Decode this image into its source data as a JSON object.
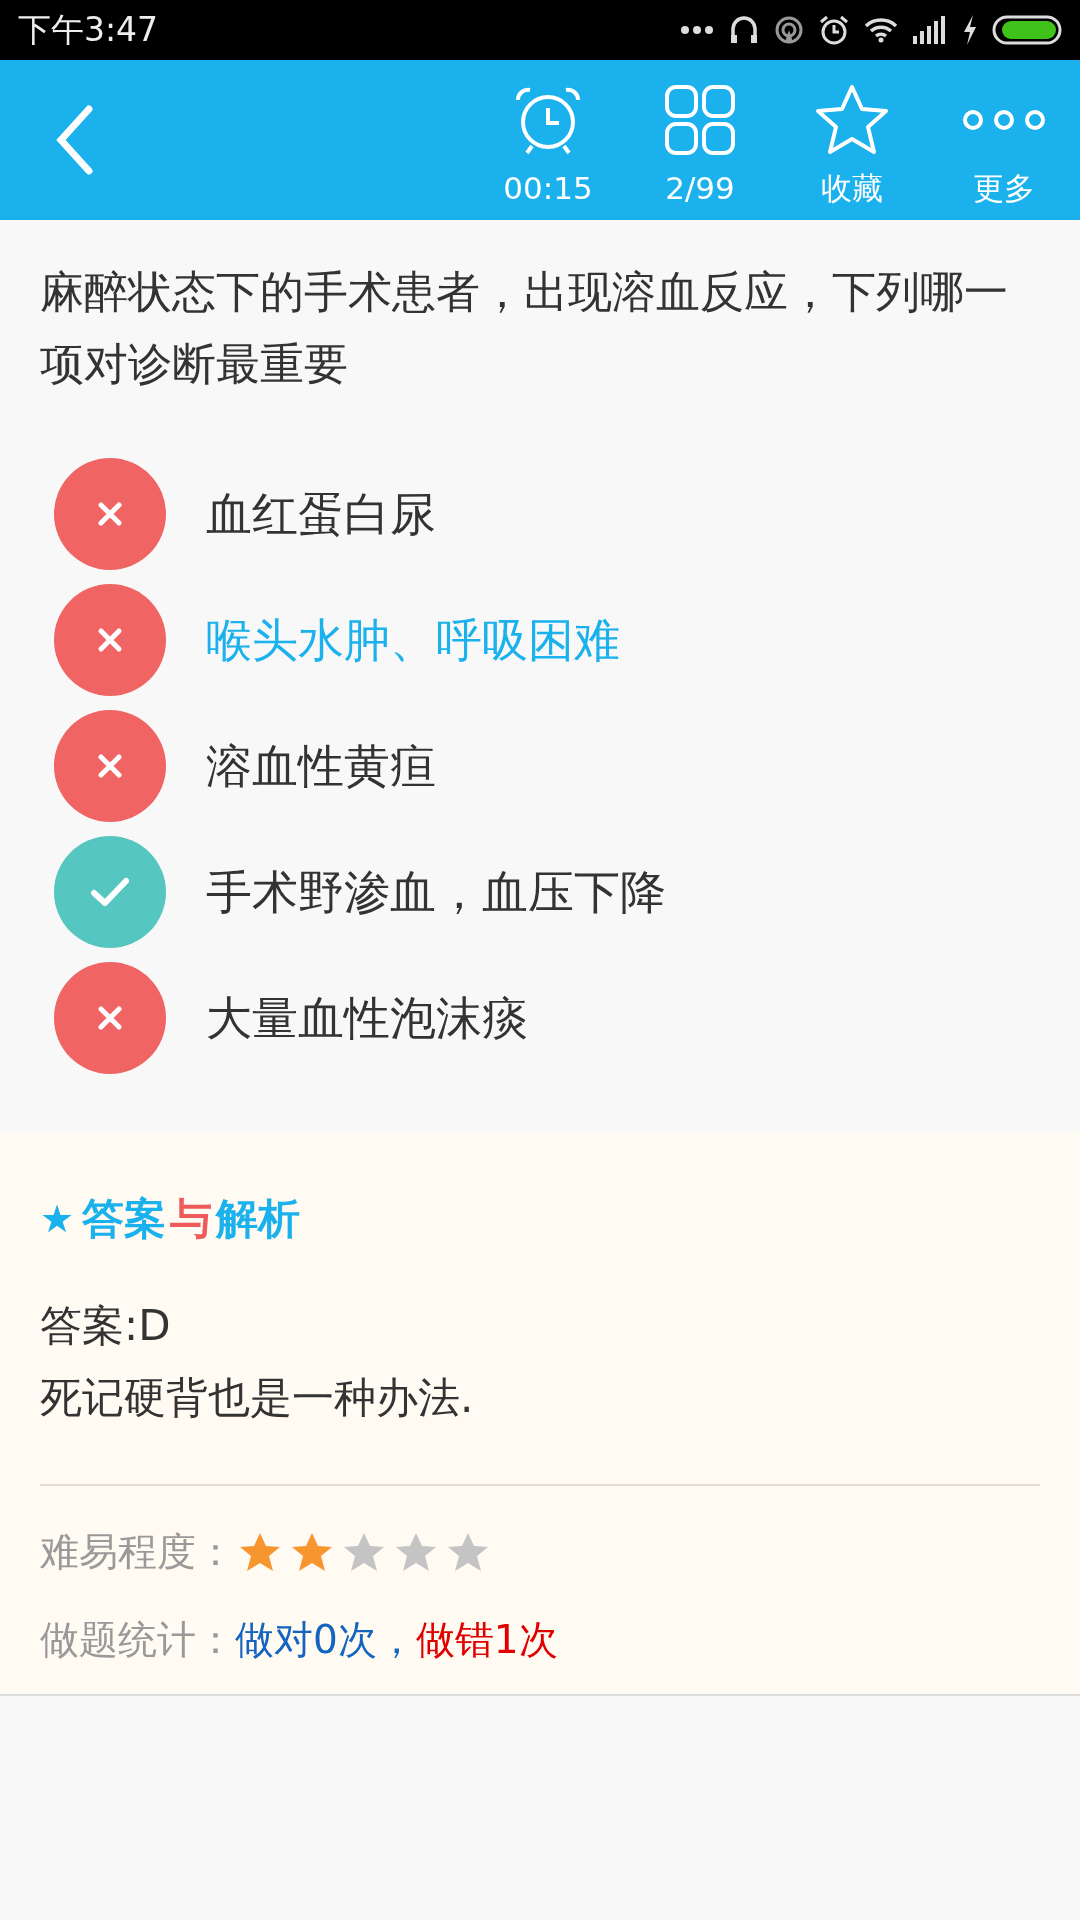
{
  "status_bar": {
    "time": "下午3:47"
  },
  "toolbar": {
    "items": [
      {
        "kind": "timer",
        "label": "00:15"
      },
      {
        "kind": "card",
        "label": "2/99"
      },
      {
        "kind": "favorite",
        "label": "收藏"
      },
      {
        "kind": "more",
        "label": "更多"
      }
    ]
  },
  "question": {
    "text": "麻醉状态下的手术患者，出现溶血反应，下列哪一项对诊断最重要"
  },
  "options": [
    {
      "text": "血红蛋白尿",
      "kind": "wrong",
      "selected": false
    },
    {
      "text": "喉头水肿、呼吸困难",
      "kind": "wrong",
      "selected": true
    },
    {
      "text": "溶血性黄疸",
      "kind": "wrong",
      "selected": false
    },
    {
      "text": "手术野渗血，血压下降",
      "kind": "correct",
      "selected": false
    },
    {
      "text": "大量血性泡沫痰",
      "kind": "wrong",
      "selected": false
    }
  ],
  "analysis": {
    "heading_parts": [
      {
        "text": "★",
        "color": "#1ab1ec"
      },
      {
        "text": "答案",
        "color": "#1ab1ec"
      },
      {
        "text": "与",
        "color": "#ef5b5b"
      },
      {
        "text": "解析",
        "color": "#1ab1ec"
      }
    ],
    "answer": "答案:D",
    "explanation": "死记硬背也是一种办法.",
    "difficulty": {
      "label": "难易程度：",
      "stars": 2
    },
    "stats": {
      "label": "做题统计：",
      "parts": [
        {
          "text": "做对0次",
          "color": "#1565c0"
        },
        {
          "text": "，",
          "color": "#1565c0"
        },
        {
          "text": "做错1次",
          "color": "#e00000"
        }
      ]
    }
  }
}
